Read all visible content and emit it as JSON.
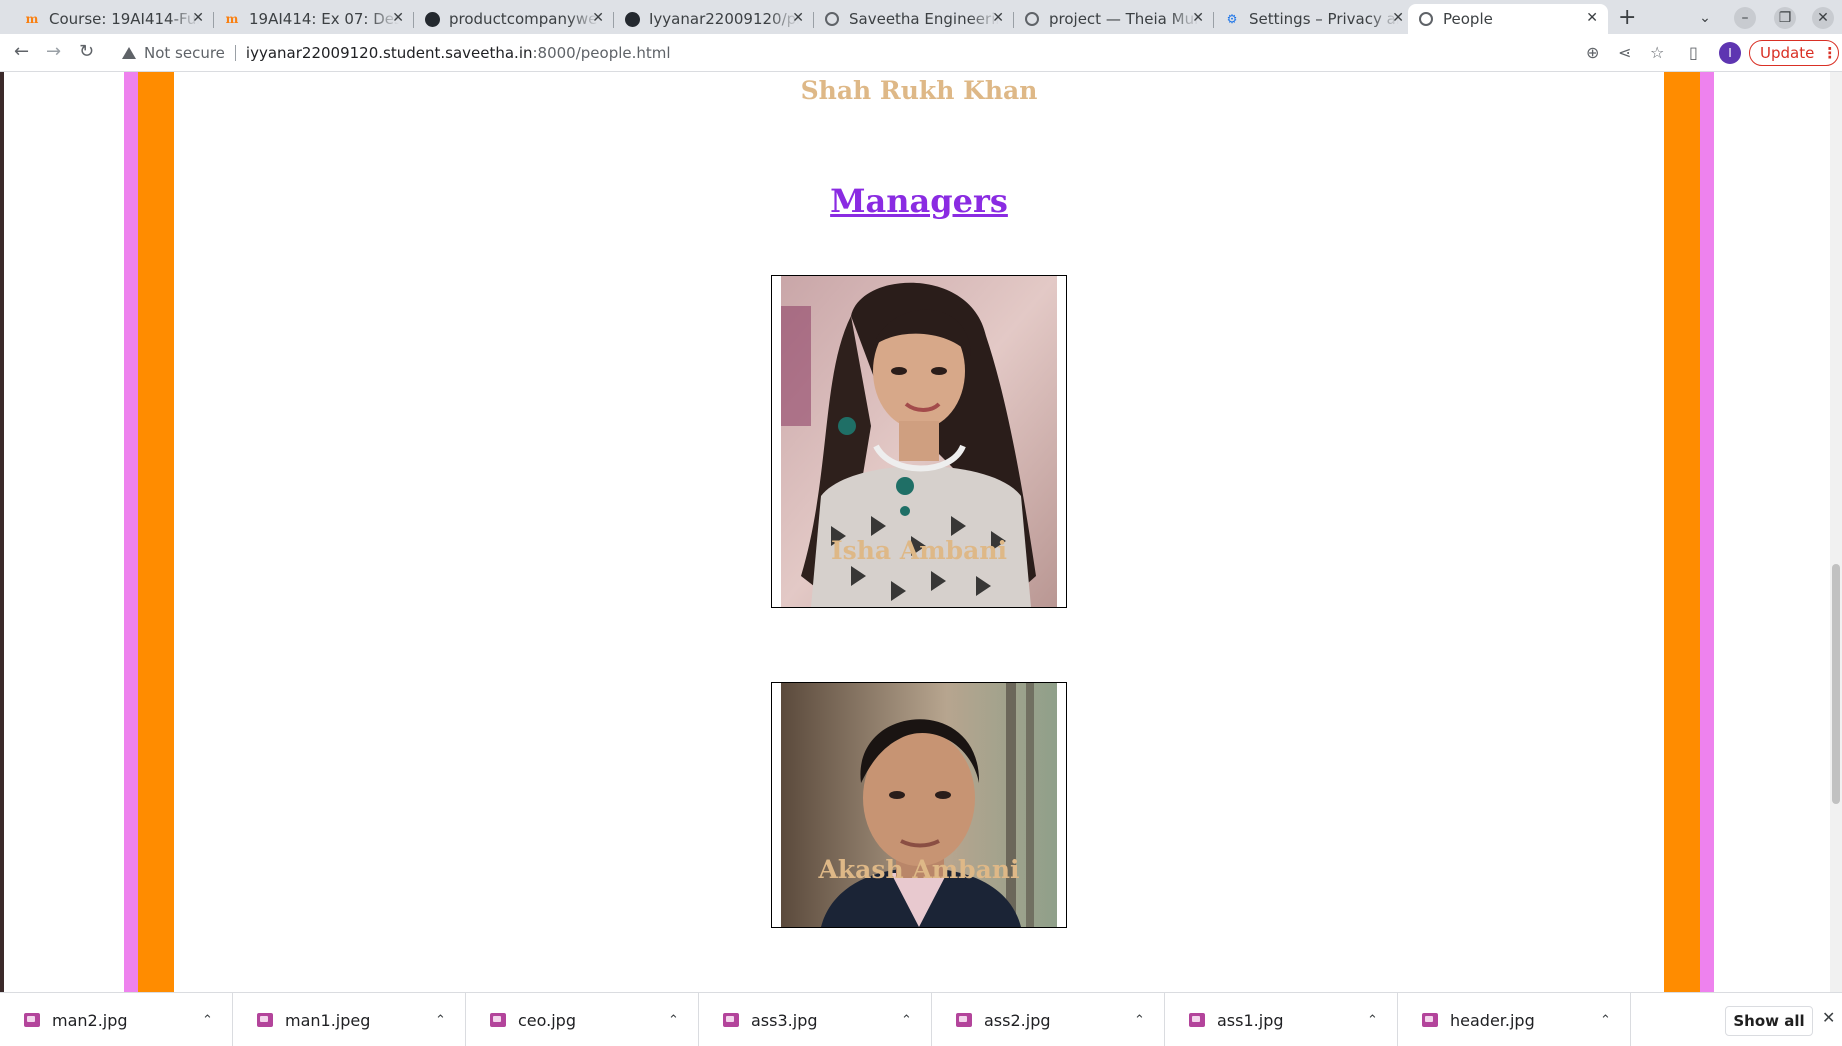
{
  "browser": {
    "tabs": [
      {
        "title": "Course: 19AI414-Fundamentals of Web Application Development",
        "icon": "moodle-icon",
        "active": false
      },
      {
        "title": "19AI414: Ex 07: Design a website",
        "icon": "moodle-icon",
        "active": false
      },
      {
        "title": "productcompanywebsite",
        "icon": "github-icon",
        "active": false
      },
      {
        "title": "Iyyanar22009120/productcompanywebsite",
        "icon": "github-icon",
        "active": false
      },
      {
        "title": "Saveetha Engineering College",
        "icon": "globe-icon",
        "active": false
      },
      {
        "title": "project — Theia Multi-Language Example",
        "icon": "globe-icon",
        "active": false
      },
      {
        "title": "Settings – Privacy and security",
        "icon": "gear-icon",
        "active": false
      },
      {
        "title": "People",
        "icon": "globe-icon",
        "active": true
      }
    ],
    "omnibox": {
      "security_label": "Not secure",
      "url_host": "iyyanar22009120.student.saveetha.in",
      "url_path": ":8000/people.html"
    },
    "profile_initial": "I",
    "update_label": "Update"
  },
  "page": {
    "colors": {
      "name": "#deb887",
      "heading": "#8a2be2",
      "band_orange": "#ff8c00",
      "band_pink": "#ee82ee"
    },
    "top_person_name": "Shah Rukh Khan",
    "section_heading": "Managers",
    "managers": [
      {
        "name": "Isha Ambani"
      },
      {
        "name": "Akash Ambani"
      }
    ]
  },
  "downloads": {
    "items": [
      {
        "name": "man2.jpg"
      },
      {
        "name": "man1.jpeg"
      },
      {
        "name": "ceo.jpg"
      },
      {
        "name": "ass3.jpg"
      },
      {
        "name": "ass2.jpg"
      },
      {
        "name": "ass1.jpg"
      },
      {
        "name": "header.jpg"
      }
    ],
    "show_all_label": "Show all"
  }
}
